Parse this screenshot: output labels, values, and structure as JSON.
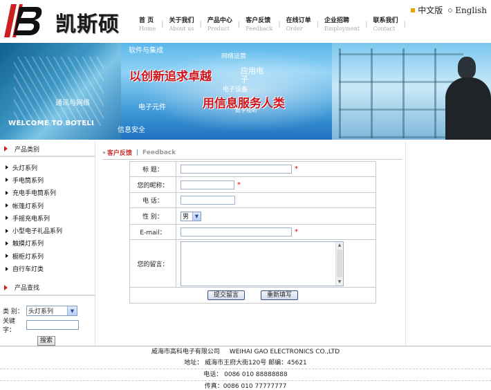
{
  "brand": {
    "name": "凯斯硕",
    "colors": {
      "accent_red": "#cc2020",
      "link_blue": "#2a6fb8",
      "required_red": "#e00000"
    }
  },
  "nav": [
    {
      "cn": "首 页",
      "en": "Home"
    },
    {
      "cn": "关于我们",
      "en": "About us"
    },
    {
      "cn": "产品中心",
      "en": "Product"
    },
    {
      "cn": "客户反馈",
      "en": "Feedback"
    },
    {
      "cn": "在线订单",
      "en": "Order"
    },
    {
      "cn": "企业招聘",
      "en": "Employment"
    },
    {
      "cn": "联系我们",
      "en": "Contact"
    }
  ],
  "lang": {
    "cn": "中文版",
    "en": "English"
  },
  "banner": {
    "slogan1": "以创新追求卓越",
    "slogan2": "用信息服务人类",
    "welcome": "WELCOME TO BOTELI",
    "terms": [
      "软件与集成",
      "网络运营",
      "应用电",
      "子",
      "电子设备",
      "数字视听",
      "通讯与网络",
      "电子元件",
      "信息安全"
    ]
  },
  "sidebar": {
    "category_title": "产品类别",
    "categories": [
      "头灯系列",
      "手电筒系列",
      "充电手电筒系列",
      "帐篷灯系列",
      "手摇充电系列",
      "小型电子礼品系列",
      "触摸灯系列",
      "橱柜灯系列",
      "自行车灯类"
    ],
    "search_title": "产品查找",
    "search": {
      "type_label": "类  别：",
      "type_value": "头灯系列",
      "keyword_label": "关键字：",
      "keyword_value": "",
      "submit_label": "搜索"
    }
  },
  "main": {
    "crumb_cn": "客户反馈",
    "crumb_en": "Feedback",
    "form": {
      "title_label": "标    题：",
      "nickname_label": "您的昵称：",
      "phone_label": "电    话：",
      "gender_label": "性    别：",
      "gender_value": "男",
      "email_label": "E-mail：",
      "message_label": "您的留言：",
      "required_mark": "*",
      "submit_label": "提交留言",
      "reset_label": "重新填写"
    }
  },
  "footer": {
    "company_cn": "威海市高科电子有限公司",
    "company_en": "WEIHAI GAO ELECTRONICS CO.,LTD",
    "address": "地址：  威海市王府大街120号  邮编：45621",
    "phone": "电话：  0086 010 88888888",
    "fax": "传真：0086 010 77777777"
  }
}
